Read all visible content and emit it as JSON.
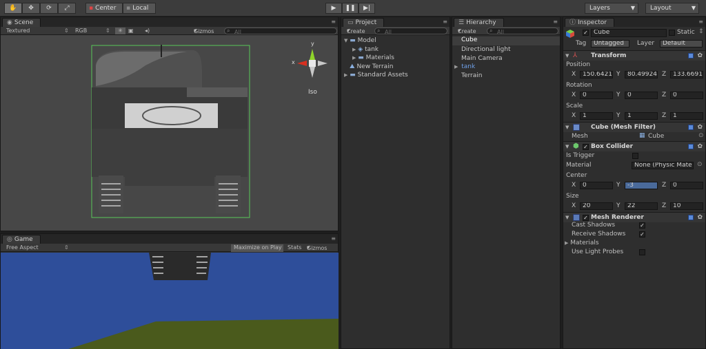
{
  "toolbar": {
    "tools": [
      "hand-tool",
      "move-tool",
      "rotate-tool",
      "scale-tool"
    ],
    "pivot_label": "Center",
    "space_label": "Local",
    "layers_label": "Layers",
    "layout_label": "Layout"
  },
  "scene": {
    "tab": "Scene",
    "render_mode": "Textured",
    "color_mode": "RGB",
    "gizmos": "Gizmos",
    "search_placeholder": "All",
    "gizmo_axis_y": "y",
    "gizmo_axis_x": "x",
    "gizmo_label": "Iso"
  },
  "game": {
    "tab": "Game",
    "aspect": "Free Aspect",
    "maximize": "Maximize on Play",
    "stats": "Stats",
    "gizmos": "Gizmos"
  },
  "project": {
    "tab": "Project",
    "create": "Create",
    "search_placeholder": "All",
    "items": [
      "Model",
      "tank",
      "Materials",
      "New Terrain",
      "Standard Assets"
    ]
  },
  "hierarchy": {
    "tab": "Hierarchy",
    "create": "Create",
    "search_placeholder": "All",
    "items": [
      "Cube",
      "Directional light",
      "Main Camera",
      "tank",
      "Terrain"
    ]
  },
  "inspector": {
    "tab": "Inspector",
    "name": "Cube",
    "static_label": "Static",
    "tag_label": "Tag",
    "tag_value": "Untagged",
    "layer_label": "Layer",
    "layer_value": "Default",
    "transform": {
      "title": "Transform",
      "position_label": "Position",
      "position": {
        "x": "150.6421",
        "y": "80.49924",
        "z": "133.6691"
      },
      "rotation_label": "Rotation",
      "rotation": {
        "x": "0",
        "y": "0",
        "z": "0"
      },
      "scale_label": "Scale",
      "scale": {
        "x": "1",
        "y": "1",
        "z": "1"
      }
    },
    "mesh_filter": {
      "title": "Cube (Mesh Filter)",
      "mesh_label": "Mesh",
      "mesh_value": "Cube"
    },
    "box_collider": {
      "title": "Box Collider",
      "is_trigger_label": "Is Trigger",
      "material_label": "Material",
      "material_value": "None (Physic Mate",
      "center_label": "Center",
      "center": {
        "x": "0",
        "y": "-3",
        "z": "0"
      },
      "size_label": "Size",
      "size": {
        "x": "20",
        "y": "22",
        "z": "10"
      }
    },
    "mesh_renderer": {
      "title": "Mesh Renderer",
      "cast_shadows_label": "Cast Shadows",
      "receive_shadows_label": "Receive Shadows",
      "materials_label": "Materials",
      "light_probes_label": "Use Light Probes"
    },
    "axis_x": "X",
    "axis_y": "Y",
    "axis_z": "Z"
  },
  "colors": {
    "game_sky": "#2e4e9a",
    "game_ground": "#4a5a1c",
    "selection_outline": "#5ac85a",
    "gizmo_y": "#8fd42a",
    "gizmo_x": "#d83020"
  }
}
